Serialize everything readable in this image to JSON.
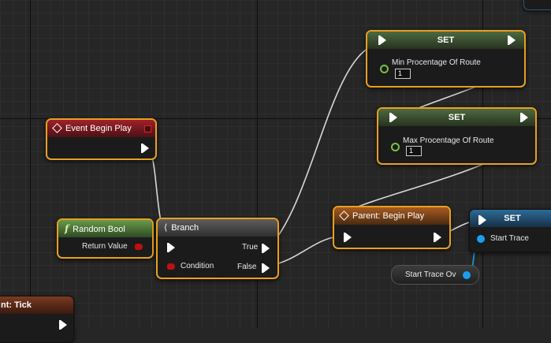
{
  "colors": {
    "selection": "#e8a020",
    "exec_wire": "#d8d8d8",
    "bool_pin": "#c01010",
    "float_pin": "#7ac040",
    "object_pin": "#1a9ff0"
  },
  "nodes": {
    "event_begin_play": {
      "title": "Event Begin Play",
      "icon": "event-diamond-icon"
    },
    "random_bool": {
      "title": "Random Bool",
      "icon": "function-icon",
      "output_label": "Return Value"
    },
    "branch": {
      "title": "Branch",
      "icon": "branch-icon",
      "condition_label": "Condition",
      "true_label": "True",
      "false_label": "False"
    },
    "set_min": {
      "title": "SET",
      "pin_label": "Min Procentage Of Route",
      "value": "1"
    },
    "set_max": {
      "title": "SET",
      "pin_label": "Max Procentage Of Route",
      "value": "1"
    },
    "parent_begin_play": {
      "title": "Parent: Begin Play",
      "icon": "event-diamond-icon"
    },
    "set_start_trace": {
      "title": "SET",
      "pin_label": "Start Trace"
    },
    "start_trace_var": {
      "label": "Start Trace Ov"
    },
    "event_tick": {
      "title": "nt: Tick"
    }
  }
}
